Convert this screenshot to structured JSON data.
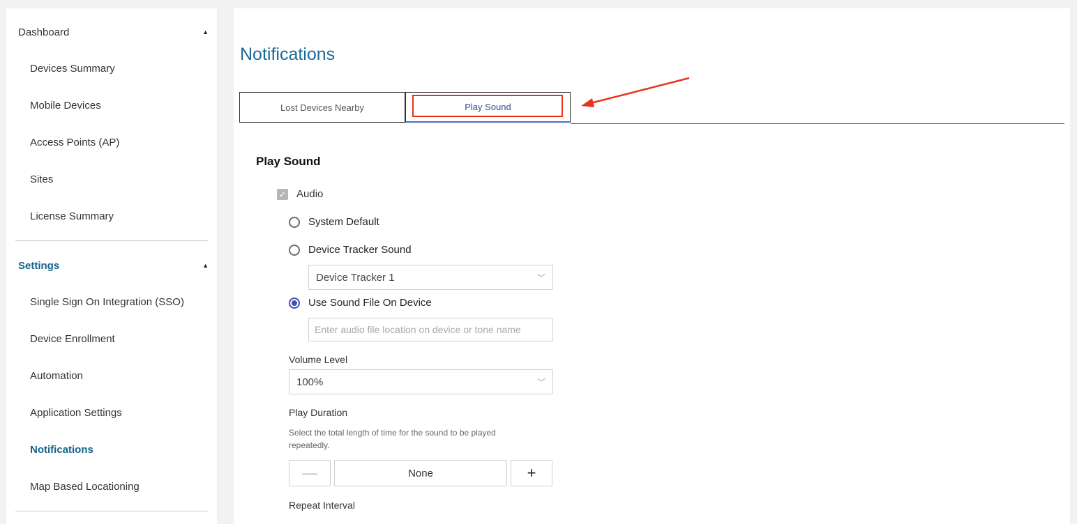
{
  "sidebar": {
    "dashboard": {
      "label": "Dashboard",
      "items": [
        "Devices Summary",
        "Mobile Devices",
        "Access Points (AP)",
        "Sites",
        "License Summary"
      ]
    },
    "settings": {
      "label": "Settings",
      "items": [
        "Single Sign On Integration (SSO)",
        "Device Enrollment",
        "Automation",
        "Application Settings",
        "Notifications",
        "Map Based Locationing"
      ]
    }
  },
  "main": {
    "title": "Notifications",
    "tabs": [
      "Lost Devices Nearby",
      "Play Sound"
    ],
    "active_tab": "Play Sound",
    "section_title": "Play Sound",
    "audio_label": "Audio",
    "audio_checked": true,
    "sound_options": [
      "System Default",
      "Device Tracker Sound",
      "Use Sound File On Device"
    ],
    "selected_sound_option": "Use Sound File On Device",
    "tracker_sound_value": "Device Tracker 1",
    "sound_file_placeholder": "Enter audio file location on device or tone name",
    "volume_label": "Volume Level",
    "volume_value": "100%",
    "duration_label": "Play Duration",
    "duration_help": "Select the total length of time for the sound to be played repeatedly.",
    "duration_value": "None",
    "repeat_label": "Repeat Interval"
  },
  "colors": {
    "accent": "#14628a",
    "title": "#1a6b96",
    "highlight": "#e8321c",
    "radio": "#3f51b5"
  },
  "icons": {
    "caret": "caret-up-icon",
    "chevron": "chevron-down-icon",
    "check": "check-icon",
    "minus": "minus-icon",
    "plus": "plus-icon",
    "arrow": "annotation-arrow-icon"
  }
}
